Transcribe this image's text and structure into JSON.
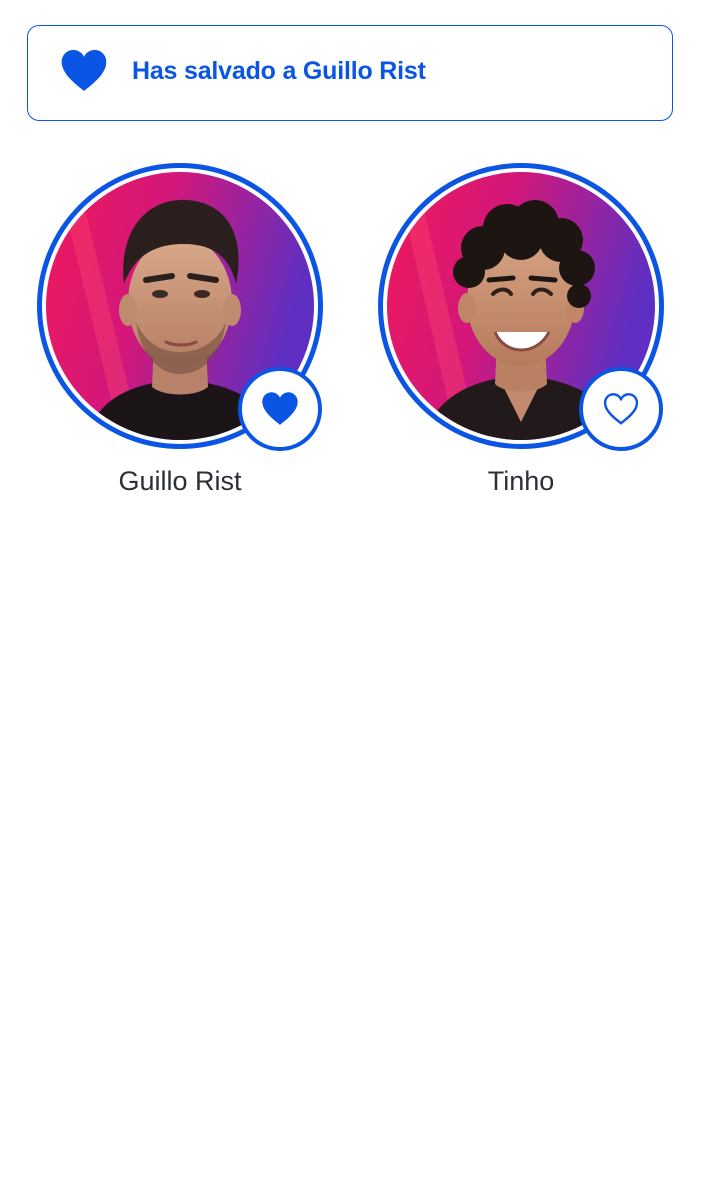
{
  "colors": {
    "accent": "#0a55e3",
    "name_text": "#2b2f38",
    "background_magenta": "#e8185a",
    "background_purple": "#6a2fc4"
  },
  "banner": {
    "icon": "heart-filled-icon",
    "message": "Has salvado a Guillo Rist"
  },
  "contestants": [
    {
      "name": "Guillo Rist",
      "saved": true,
      "favorite_icon": "heart-filled-icon"
    },
    {
      "name": "Tinho",
      "saved": false,
      "favorite_icon": "heart-outline-icon"
    }
  ]
}
